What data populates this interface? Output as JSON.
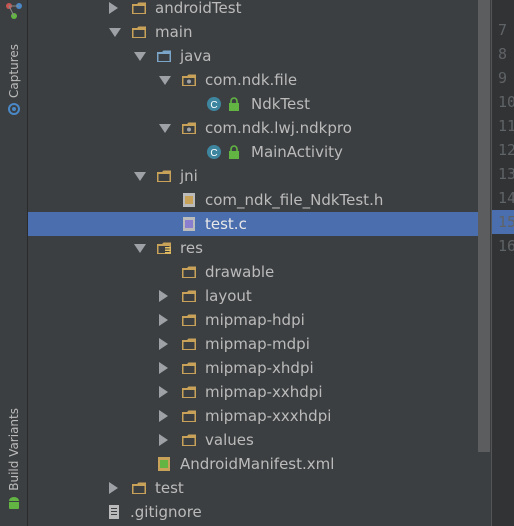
{
  "sidebar": {
    "top_tab": "Captures",
    "bottom_tab": "Build Variants"
  },
  "tree": {
    "rows": [
      {
        "name": "tree-item-androidtest",
        "label": "androidTest",
        "depth": 0,
        "arrow": "right",
        "icon": "folder-icon"
      },
      {
        "name": "tree-item-main",
        "label": "main",
        "depth": 0,
        "arrow": "down",
        "icon": "folder-icon"
      },
      {
        "name": "tree-item-java",
        "label": "java",
        "depth": 1,
        "arrow": "down",
        "icon": "source-folder-icon"
      },
      {
        "name": "tree-item-com-ndk-file",
        "label": "com.ndk.file",
        "depth": 2,
        "arrow": "down",
        "icon": "package-icon"
      },
      {
        "name": "tree-item-ndktest",
        "label": "NdkTest",
        "depth": 3,
        "arrow": "none",
        "icon": "class-icon"
      },
      {
        "name": "tree-item-com-ndk-lwj-ndkpro",
        "label": "com.ndk.lwj.ndkpro",
        "depth": 2,
        "arrow": "down",
        "icon": "package-icon"
      },
      {
        "name": "tree-item-mainactivity",
        "label": "MainActivity",
        "depth": 3,
        "arrow": "none",
        "icon": "class-icon"
      },
      {
        "name": "tree-item-jni",
        "label": "jni",
        "depth": 1,
        "arrow": "down",
        "icon": "folder-icon"
      },
      {
        "name": "tree-item-header-file",
        "label": "com_ndk_file_NdkTest.h",
        "depth": 2,
        "arrow": "none",
        "icon": "h-file-icon"
      },
      {
        "name": "tree-item-test-c",
        "label": "test.c",
        "depth": 2,
        "arrow": "none",
        "icon": "c-file-icon",
        "selected": true
      },
      {
        "name": "tree-item-res",
        "label": "res",
        "depth": 1,
        "arrow": "down",
        "icon": "resource-folder-icon"
      },
      {
        "name": "tree-item-drawable",
        "label": "drawable",
        "depth": 2,
        "arrow": "none",
        "icon": "folder-icon"
      },
      {
        "name": "tree-item-layout",
        "label": "layout",
        "depth": 2,
        "arrow": "right",
        "icon": "folder-icon"
      },
      {
        "name": "tree-item-mipmap-hdpi",
        "label": "mipmap-hdpi",
        "depth": 2,
        "arrow": "right",
        "icon": "folder-icon"
      },
      {
        "name": "tree-item-mipmap-mdpi",
        "label": "mipmap-mdpi",
        "depth": 2,
        "arrow": "right",
        "icon": "folder-icon"
      },
      {
        "name": "tree-item-mipmap-xhdpi",
        "label": "mipmap-xhdpi",
        "depth": 2,
        "arrow": "right",
        "icon": "folder-icon"
      },
      {
        "name": "tree-item-mipmap-xxhdpi",
        "label": "mipmap-xxhdpi",
        "depth": 2,
        "arrow": "right",
        "icon": "folder-icon"
      },
      {
        "name": "tree-item-mipmap-xxxhdpi",
        "label": "mipmap-xxxhdpi",
        "depth": 2,
        "arrow": "right",
        "icon": "folder-icon"
      },
      {
        "name": "tree-item-values",
        "label": "values",
        "depth": 2,
        "arrow": "right",
        "icon": "folder-icon"
      },
      {
        "name": "tree-item-androidmanifest",
        "label": "AndroidManifest.xml",
        "depth": 1,
        "arrow": "none",
        "icon": "manifest-icon"
      },
      {
        "name": "tree-item-test",
        "label": "test",
        "depth": 0,
        "arrow": "right",
        "icon": "folder-icon"
      },
      {
        "name": "tree-item-gitignore",
        "label": ".gitignore",
        "depth": -1,
        "arrow": "none",
        "icon": "text-file-icon"
      }
    ]
  },
  "editor": {
    "line_numbers": [
      "7",
      "8",
      "9",
      "10",
      "11",
      "12",
      "13",
      "14",
      "15",
      "16"
    ]
  },
  "colors": {
    "background": "#3c3f41",
    "selection": "#4b6eaf",
    "folder": "#c9a25a",
    "class_badge": "#3e86a0",
    "lock": "#62b543"
  }
}
